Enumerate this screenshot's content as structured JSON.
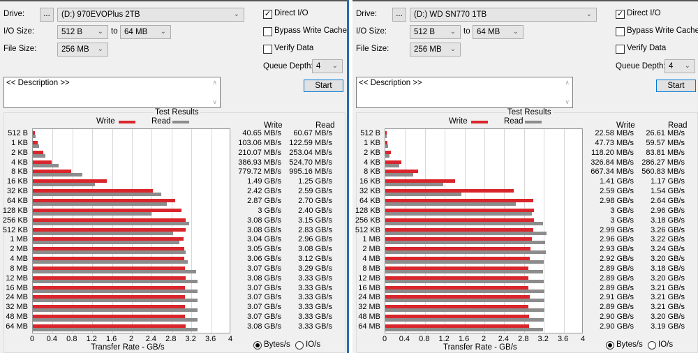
{
  "colors": {
    "write": "#d9262c",
    "read": "#8c8c8c",
    "accent": "#2b6cb0"
  },
  "labels": {
    "drive": "Drive:",
    "io_size": "I/O Size:",
    "to": "to",
    "file_size": "File Size:",
    "direct_io": "Direct I/O",
    "bypass": "Bypass Write Cache",
    "verify": "Verify Data",
    "queue_depth": "Queue Depth:",
    "browse": "...",
    "start": "Start",
    "description": "<< Description >>",
    "test_results": "Test Results",
    "write": "Write",
    "read": "Read",
    "x_axis_title": "Transfer Rate - GB/s",
    "bytes": "Bytes/s",
    "ios": "IO/s"
  },
  "x_ticks": [
    "0",
    "0.4",
    "0.8",
    "1.2",
    "1.6",
    "2",
    "2.4",
    "2.8",
    "3.2",
    "3.6",
    "4"
  ],
  "panels": [
    {
      "drive": "(D:) 970EVOPlus 2TB",
      "io_from": "512 B",
      "io_to": "64 MB",
      "file_size": "256 MB",
      "queue_depth": "4",
      "direct_io": true,
      "bypass": false,
      "verify": false,
      "units": "bytes",
      "chart_data": {
        "type": "bar",
        "xlabel": "Transfer Rate - GB/s",
        "xlim": [
          0,
          4
        ],
        "categories": [
          "512 B",
          "1 KB",
          "2 KB",
          "4 KB",
          "8 KB",
          "16 KB",
          "32 KB",
          "64 KB",
          "128 KB",
          "256 KB",
          "512 KB",
          "1 MB",
          "2 MB",
          "4 MB",
          "8 MB",
          "12 MB",
          "16 MB",
          "24 MB",
          "32 MB",
          "48 MB",
          "64 MB"
        ],
        "series": [
          {
            "name": "Write",
            "values": [
              0.04065,
              0.10306,
              0.21007,
              0.38693,
              0.77972,
              1.49,
              2.42,
              2.87,
              3,
              3.08,
              3.08,
              3.04,
              3.05,
              3.06,
              3.07,
              3.08,
              3.07,
              3.07,
              3.07,
              3.07,
              3.08
            ]
          },
          {
            "name": "Read",
            "values": [
              0.06067,
              0.12259,
              0.25304,
              0.5247,
              0.99516,
              1.25,
              2.59,
              2.7,
              2.4,
              3.15,
              2.83,
              2.96,
              3.08,
              3.12,
              3.29,
              3.33,
              3.33,
              3.33,
              3.33,
              3.33,
              3.33
            ]
          }
        ]
      },
      "write_text": [
        "40.65 MB/s",
        "103.06 MB/s",
        "210.07 MB/s",
        "386.93 MB/s",
        "779.72 MB/s",
        "1.49 GB/s",
        "2.42 GB/s",
        "2.87 GB/s",
        "3 GB/s",
        "3.08 GB/s",
        "3.08 GB/s",
        "3.04 GB/s",
        "3.05 GB/s",
        "3.06 GB/s",
        "3.07 GB/s",
        "3.08 GB/s",
        "3.07 GB/s",
        "3.07 GB/s",
        "3.07 GB/s",
        "3.07 GB/s",
        "3.08 GB/s"
      ],
      "read_text": [
        "60.67 MB/s",
        "122.59 MB/s",
        "253.04 MB/s",
        "524.70 MB/s",
        "995.16 MB/s",
        "1.25 GB/s",
        "2.59 GB/s",
        "2.70 GB/s",
        "2.40 GB/s",
        "3.15 GB/s",
        "2.83 GB/s",
        "2.96 GB/s",
        "3.08 GB/s",
        "3.12 GB/s",
        "3.29 GB/s",
        "3.33 GB/s",
        "3.33 GB/s",
        "3.33 GB/s",
        "3.33 GB/s",
        "3.33 GB/s",
        "3.33 GB/s"
      ]
    },
    {
      "drive": "(D:) WD SN770 1TB",
      "io_from": "512 B",
      "io_to": "64 MB",
      "file_size": "256 MB",
      "queue_depth": "4",
      "direct_io": true,
      "bypass": false,
      "verify": false,
      "units": "bytes",
      "chart_data": {
        "type": "bar",
        "xlabel": "Transfer Rate - GB/s",
        "xlim": [
          0,
          4
        ],
        "categories": [
          "512 B",
          "1 KB",
          "2 KB",
          "4 KB",
          "8 KB",
          "16 KB",
          "32 KB",
          "64 KB",
          "128 KB",
          "256 KB",
          "512 KB",
          "1 MB",
          "2 MB",
          "4 MB",
          "8 MB",
          "12 MB",
          "16 MB",
          "24 MB",
          "32 MB",
          "48 MB",
          "64 MB"
        ],
        "series": [
          {
            "name": "Write",
            "values": [
              0.02258,
              0.04773,
              0.1182,
              0.32684,
              0.66734,
              1.41,
              2.59,
              2.98,
              3,
              3,
              2.99,
              2.96,
              2.93,
              2.92,
              2.89,
              2.89,
              2.89,
              2.91,
              2.89,
              2.9,
              2.9
            ]
          },
          {
            "name": "Read",
            "values": [
              0.02661,
              0.05957,
              0.08381,
              0.28627,
              0.56083,
              1.17,
              1.54,
              2.64,
              2.96,
              3.18,
              3.26,
              3.22,
              3.24,
              3.2,
              3.18,
              3.2,
              3.21,
              3.21,
              3.21,
              3.2,
              3.19
            ]
          }
        ]
      },
      "write_text": [
        "22.58 MB/s",
        "47.73 MB/s",
        "118.20 MB/s",
        "326.84 MB/s",
        "667.34 MB/s",
        "1.41 GB/s",
        "2.59 GB/s",
        "2.98 GB/s",
        "3 GB/s",
        "3 GB/s",
        "2.99 GB/s",
        "2.96 GB/s",
        "2.93 GB/s",
        "2.92 GB/s",
        "2.89 GB/s",
        "2.89 GB/s",
        "2.89 GB/s",
        "2.91 GB/s",
        "2.89 GB/s",
        "2.90 GB/s",
        "2.90 GB/s"
      ],
      "read_text": [
        "26.61 MB/s",
        "59.57 MB/s",
        "83.81 MB/s",
        "286.27 MB/s",
        "560.83 MB/s",
        "1.17 GB/s",
        "1.54 GB/s",
        "2.64 GB/s",
        "2.96 GB/s",
        "3.18 GB/s",
        "3.26 GB/s",
        "3.22 GB/s",
        "3.24 GB/s",
        "3.20 GB/s",
        "3.18 GB/s",
        "3.20 GB/s",
        "3.21 GB/s",
        "3.21 GB/s",
        "3.21 GB/s",
        "3.20 GB/s",
        "3.19 GB/s"
      ]
    }
  ]
}
